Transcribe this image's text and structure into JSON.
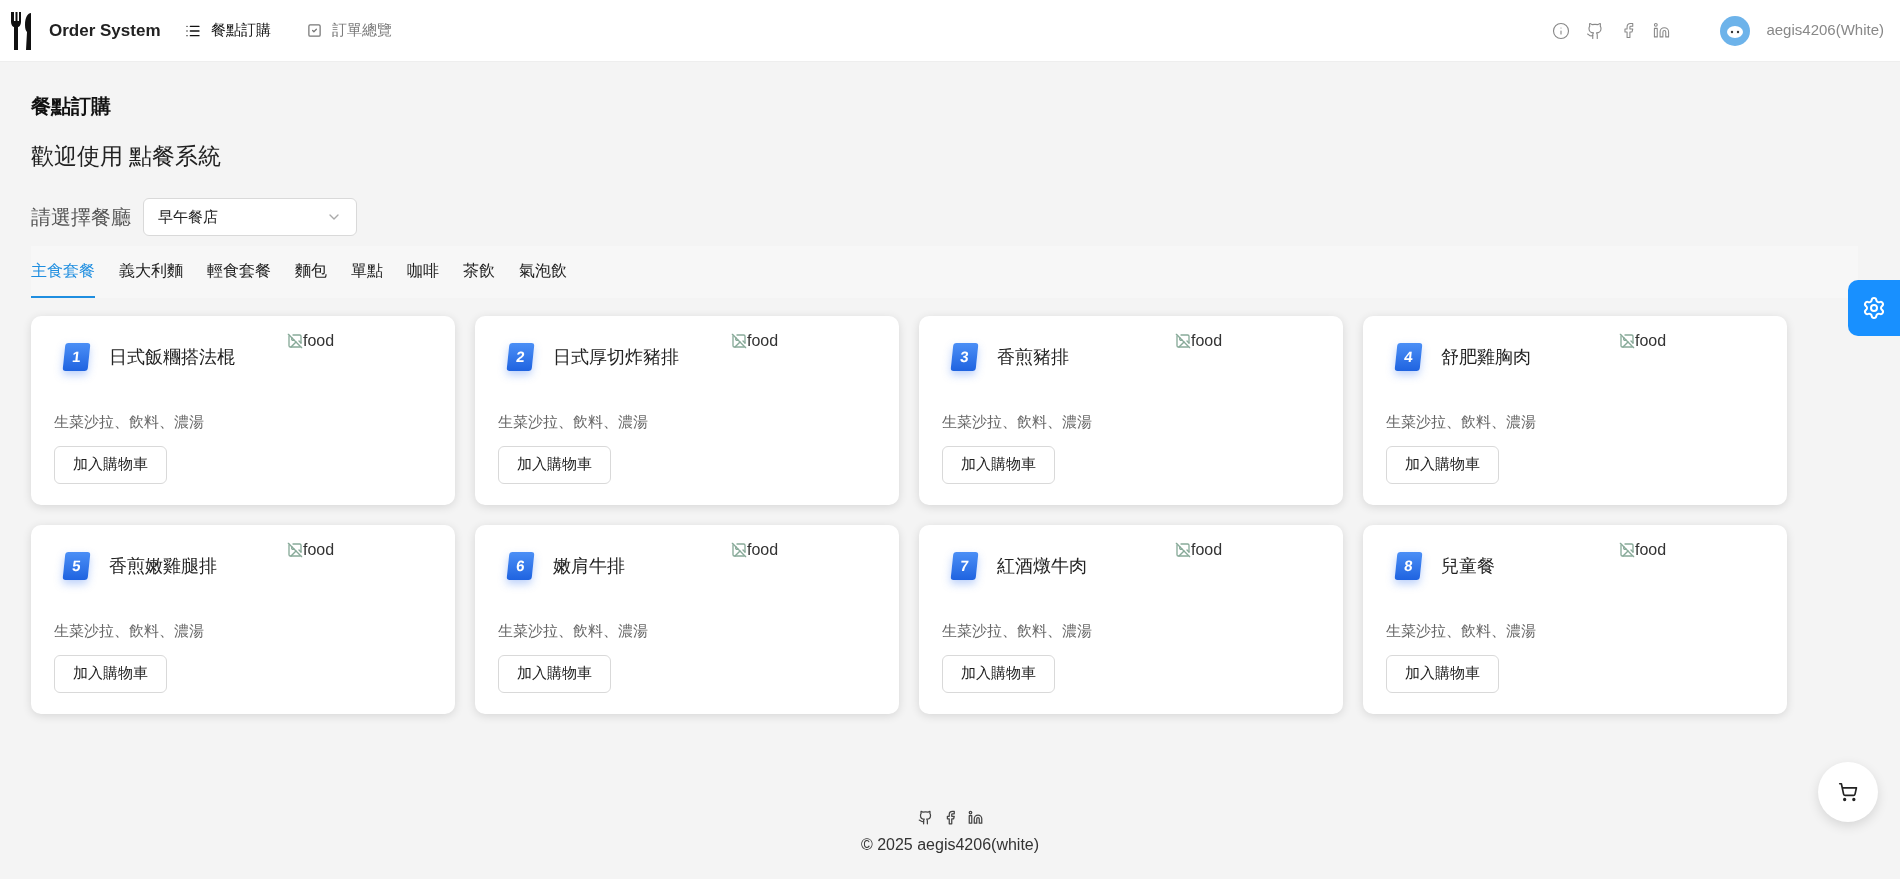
{
  "header": {
    "brand": "Order System",
    "nav": [
      {
        "label": "餐點訂購",
        "kind": "list",
        "selected": true
      },
      {
        "label": "訂單總覽",
        "kind": "check",
        "selected": false
      }
    ],
    "user": "aegis4206(White)"
  },
  "page_title": "餐點訂購",
  "welcome": "歡迎使用 點餐系統",
  "restaurant": {
    "label": "請選擇餐廳",
    "value": "早午餐店"
  },
  "tabs": [
    {
      "label": "主食套餐",
      "selected": true
    },
    {
      "label": "義大利麵",
      "selected": false
    },
    {
      "label": "輕食套餐",
      "selected": false
    },
    {
      "label": "麵包",
      "selected": false
    },
    {
      "label": "單點",
      "selected": false
    },
    {
      "label": "咖啡",
      "selected": false
    },
    {
      "label": "茶飲",
      "selected": false
    },
    {
      "label": "氣泡飲",
      "selected": false
    }
  ],
  "items": [
    {
      "number": "1",
      "name": "日式飯糰搭法棍",
      "image_alt": "food",
      "description": "生菜沙拉、飲料、濃湯",
      "button": "加入購物車"
    },
    {
      "number": "2",
      "name": "日式厚切炸豬排",
      "image_alt": "food",
      "description": "生菜沙拉、飲料、濃湯",
      "button": "加入購物車"
    },
    {
      "number": "3",
      "name": "香煎豬排",
      "image_alt": "food",
      "description": "生菜沙拉、飲料、濃湯",
      "button": "加入購物車"
    },
    {
      "number": "4",
      "name": "舒肥雞胸肉",
      "image_alt": "food",
      "description": "生菜沙拉、飲料、濃湯",
      "button": "加入購物車"
    },
    {
      "number": "5",
      "name": "香煎嫩雞腿排",
      "image_alt": "food",
      "description": "生菜沙拉、飲料、濃湯",
      "button": "加入購物車"
    },
    {
      "number": "6",
      "name": "嫩肩牛排",
      "image_alt": "food",
      "description": "生菜沙拉、飲料、濃湯",
      "button": "加入購物車"
    },
    {
      "number": "7",
      "name": "紅酒燉牛肉",
      "image_alt": "food",
      "description": "生菜沙拉、飲料、濃湯",
      "button": "加入購物車"
    },
    {
      "number": "8",
      "name": "兒童餐",
      "image_alt": "food",
      "description": "生菜沙拉、飲料、濃湯",
      "button": "加入購物車"
    }
  ],
  "footer": {
    "copyright": "© 2025 aegis4206(white)"
  }
}
